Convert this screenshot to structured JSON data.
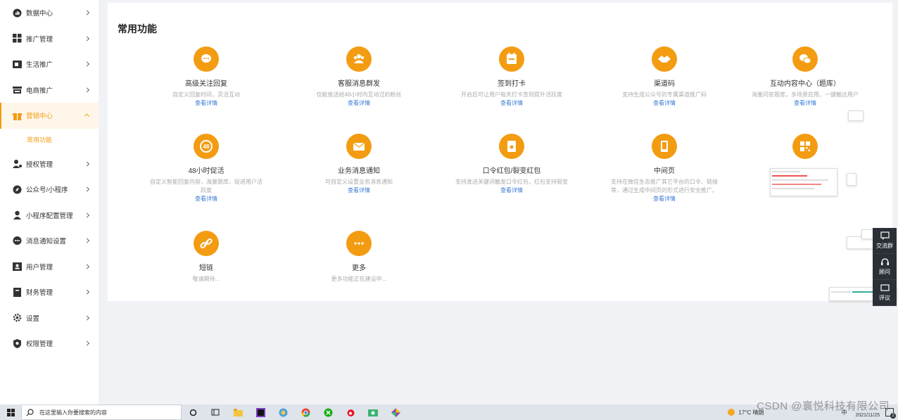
{
  "sidebar": {
    "items": [
      {
        "label": "数据中心",
        "icon": "chart-icon"
      },
      {
        "label": "推广管理",
        "icon": "grid-icon"
      },
      {
        "label": "生活推广",
        "icon": "calendar-icon"
      },
      {
        "label": "电商推广",
        "icon": "store-icon"
      },
      {
        "label": "营销中心",
        "icon": "gift-icon",
        "active": true
      },
      {
        "label": "授权管理",
        "icon": "user-key-icon"
      },
      {
        "label": "公众号/小程序",
        "icon": "compass-icon"
      },
      {
        "label": "小程序配置管理",
        "icon": "user-icon"
      },
      {
        "label": "消息通知设置",
        "icon": "chat-icon"
      },
      {
        "label": "用户管理",
        "icon": "contacts-icon"
      },
      {
        "label": "财务管理",
        "icon": "book-icon"
      },
      {
        "label": "设置",
        "icon": "gear-icon"
      },
      {
        "label": "权限管理",
        "icon": "shield-icon"
      }
    ],
    "sub_item": "常用功能"
  },
  "main": {
    "title": "常用功能",
    "features": [
      {
        "title": "高级关注回复",
        "desc": "自定义回复时间，灵活互动",
        "link": "查看详情",
        "icon": "chat-bubble-icon"
      },
      {
        "title": "客服消息群发",
        "desc": "仅能推送给48小时内互动过的粉丝",
        "link": "查看详情",
        "icon": "group-icon"
      },
      {
        "title": "签到打卡",
        "desc": "开启后可让用户每天打卡签到提升活跃度",
        "link": "查看详情",
        "icon": "calendar-check-icon"
      },
      {
        "title": "渠道码",
        "desc": "支持生成公众号的专属渠道推广码",
        "link": "查看详情",
        "icon": "handshake-icon"
      },
      {
        "title": "互动内容中心（题库）",
        "desc": "海量问答题库，多场景应用，一键触达用户",
        "link": "查看详情",
        "icon": "dialog-icon"
      },
      {
        "title": "48小时促活",
        "desc": "自定义智能回复内容，海量题库，促进用户活跃度",
        "link": "查看详情",
        "icon": "clock-48-icon"
      },
      {
        "title": "业务消息通知",
        "desc": "可自定义设置业务消息通知",
        "link": "查看详情",
        "icon": "mail-icon"
      },
      {
        "title": "口令红包/裂变红包",
        "desc": "支持发送关键词触发口令红包，红包支持裂变",
        "link": "查看详情",
        "icon": "red-packet-icon"
      },
      {
        "title": "中间页",
        "desc": "支持在微信生态推广其它平台的口令、链接等，通过生成中间页的形式进行安全推广。",
        "link": "查看详情",
        "icon": "tablet-icon"
      },
      {
        "title": "",
        "desc": "",
        "link": "",
        "icon": "qrcode-icon"
      },
      {
        "title": "短链",
        "desc": "敬请期待...",
        "link": "",
        "icon": "link-icon"
      },
      {
        "title": "更多",
        "desc": "更多功能正在建设中...",
        "link": "",
        "icon": "more-icon"
      }
    ]
  },
  "dock": {
    "items": [
      {
        "label": "交流群",
        "icon": "chat-square-icon"
      },
      {
        "label": "顾问",
        "icon": "headset-icon"
      },
      {
        "label": "评议",
        "icon": "comment-icon"
      }
    ]
  },
  "taskbar": {
    "search_placeholder": "在这里输入你要搜索的内容",
    "weather": "17°C 晴朗",
    "date": "2021/11/25",
    "lang": "中",
    "notif_count": "2"
  },
  "watermark": "CSDN @寰悦科技有限公司",
  "colors": {
    "accent": "#f39c12",
    "link": "#3a7bd5",
    "dock": "#2b2f36"
  }
}
